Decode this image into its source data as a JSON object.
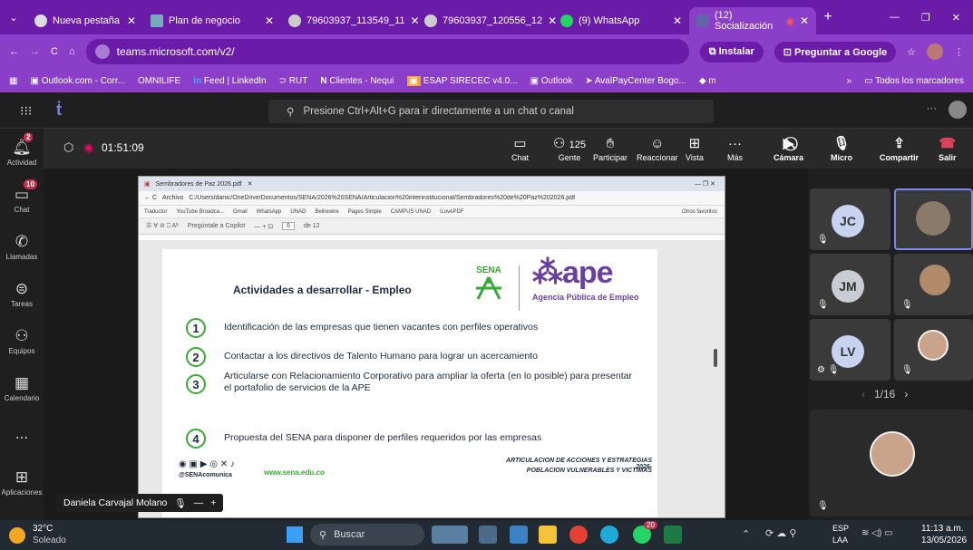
{
  "browser": {
    "tabs": [
      {
        "label": "Nueva pestaña"
      },
      {
        "label": "Plan de negocio"
      },
      {
        "label": "79603937_113549_11"
      },
      {
        "label": "79603937_120556_12"
      },
      {
        "label": "(9) WhatsApp"
      },
      {
        "label": "(12) Socialización"
      }
    ],
    "url": "teams.microsoft.com/v2/",
    "install_label": "Instalar",
    "ask_google_label": "Preguntar a Google",
    "bookmarks": [
      "Outlook.com - Corr...",
      "OMNILIFE",
      "Feed | LinkedIn",
      "RUT",
      "Clientes - Nequi",
      "ESAP SIRECEC v4.0...",
      "Outlook",
      "AvalPayCenter Bogo...",
      "m"
    ],
    "all_bookmarks_label": "Todos los marcadores",
    "more_bookmarks": "»"
  },
  "teams": {
    "search_placeholder": "Presione Ctrl+Alt+G para ir directamente a un chat o canal",
    "rail": [
      {
        "label": "Actividad",
        "badge": "2",
        "icon": "bell-icon"
      },
      {
        "label": "Chat",
        "badge": "10",
        "icon": "chat-icon"
      },
      {
        "label": "Llamadas",
        "icon": "phone-icon"
      },
      {
        "label": "Tareas",
        "icon": "tasks-icon"
      },
      {
        "label": "Equipos",
        "icon": "teams-icon"
      },
      {
        "label": "Calendario",
        "icon": "calendar-icon"
      },
      {
        "label": "...",
        "icon": "more-icon"
      },
      {
        "label": "Aplicaciones",
        "icon": "apps-icon"
      }
    ],
    "meeting": {
      "timer": "01:51:09",
      "participants_count": "125",
      "buttons": {
        "chat": "Chat",
        "people": "Gente",
        "raise": "Participar",
        "react": "Reaccionar",
        "view": "Vista",
        "more": "Más",
        "camera": "Cámara",
        "mic": "Micro",
        "share": "Compartir",
        "leave": "Salir"
      }
    },
    "presenter_name": "Daniela Carvajal Molano",
    "gallery": {
      "page": "1/16",
      "participants": [
        {
          "initials": "JC",
          "color": "#c7d3ef"
        },
        {
          "initials": "JM",
          "color": "#c9ccd3"
        },
        {
          "initials": "LV",
          "color": "#c7d3ef"
        }
      ]
    }
  },
  "shared": {
    "tab_label": "Sembradores de Paz 2026.pdf",
    "path_label": "Archivo",
    "path": "C:/Users/danic/OneDrive/Documentos/SENA/2026%20SENA/Articulación%20interinstitucional/Sembradores%20de%20Paz%202026.pdf",
    "bookmarks": [
      "Traductor",
      "YouTube Broadca...",
      "Gmail",
      "WhatsApp",
      "UNAD",
      "Bellrewire",
      "Pages Simple",
      "CAMPUS UNAD",
      "iLovePDF",
      "Otros favoritos"
    ],
    "copilot_label": "Pregúntale a Copilot",
    "page_num": "6",
    "page_total": "de 12",
    "doc": {
      "title": "Actividades a desarrollar - Empleo",
      "sena": "SENA",
      "ape": "ape",
      "ape_sub": "Agencia Pública de Empleo",
      "items": [
        {
          "n": "1",
          "text": "Identificación de las empresas que tienen vacantes con perfiles operativos"
        },
        {
          "n": "2",
          "text": "Contactar a los directivos de Talento Humano para lograr un acercamiento"
        },
        {
          "n": "3",
          "text": "Articularse con Relacionamiento Corporativo para ampliar la oferta (en lo posible) para presentar el portafolio de servicios de la APE"
        },
        {
          "n": "4",
          "text": "Propuesta del SENA para disponer de perfiles requeridos por las empresas"
        }
      ],
      "social": "@SENAcomunica",
      "web": "www.sena.edu.co",
      "footer1": "ARTICULACION DE ACCIONES Y ESTRATEGIAS 2026-",
      "footer2": "POBLACION VULNERABLES Y VICTIMAS"
    }
  },
  "taskbar": {
    "temp": "32°C",
    "weather": "Soleado",
    "search": "Buscar",
    "lang1": "ESP",
    "lang2": "LAA",
    "time": "11:13 a.m.",
    "date": "13/05/2026",
    "badge": "20"
  }
}
